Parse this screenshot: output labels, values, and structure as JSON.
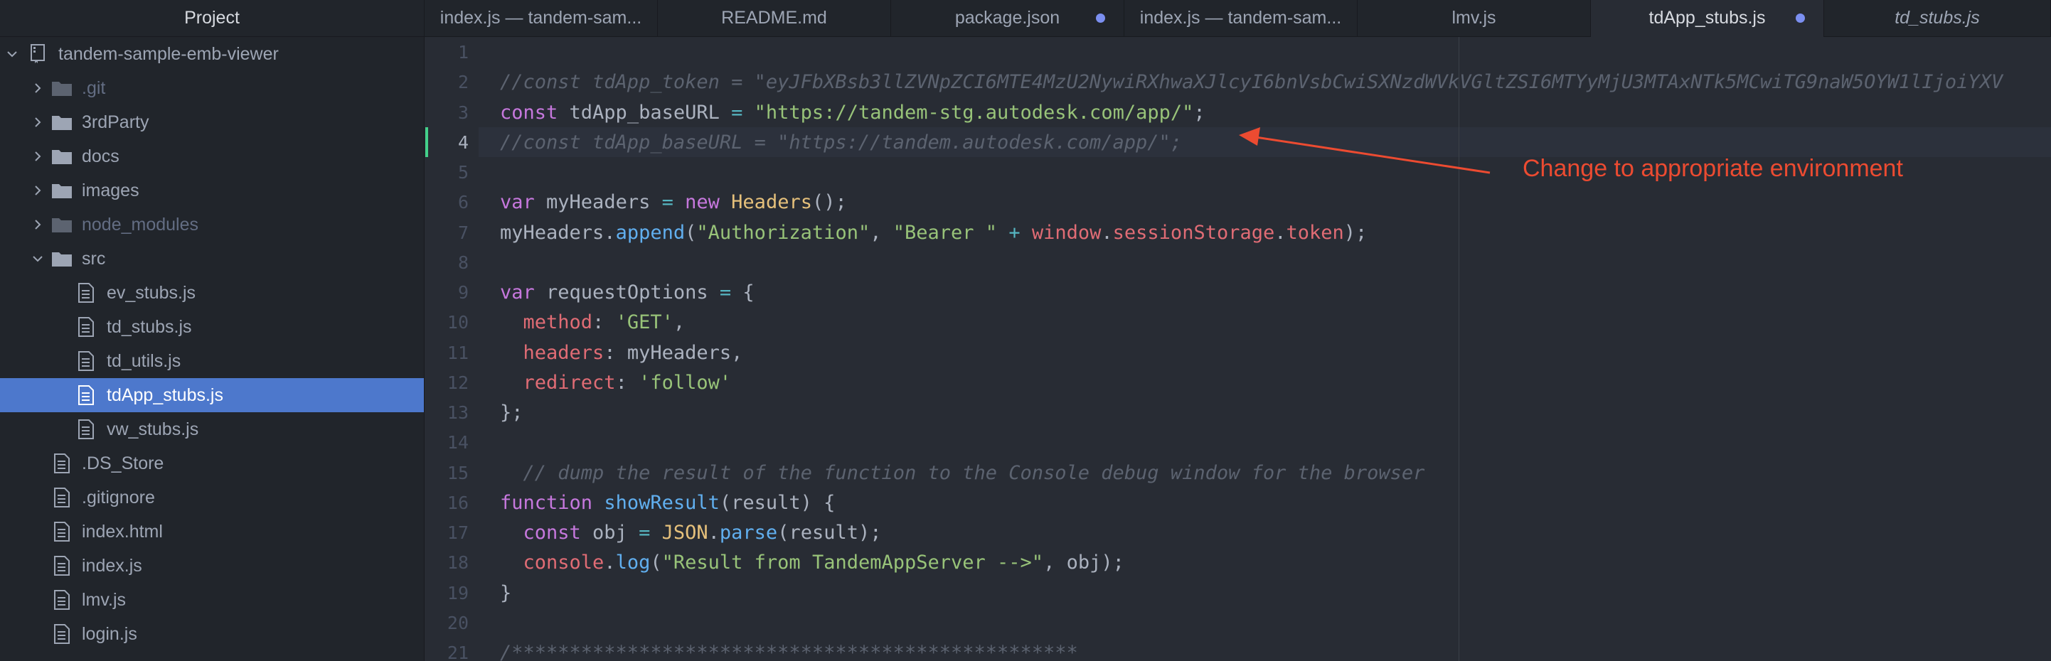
{
  "sidebar": {
    "title": "Project",
    "tree": [
      {
        "label": "tandem-sample-emb-viewer",
        "kind": "repo",
        "indent": 0,
        "expanded": true
      },
      {
        "label": ".git",
        "kind": "folder",
        "indent": 1,
        "expanded": false,
        "ignored": true
      },
      {
        "label": "3rdParty",
        "kind": "folder",
        "indent": 1,
        "expanded": false
      },
      {
        "label": "docs",
        "kind": "folder",
        "indent": 1,
        "expanded": false
      },
      {
        "label": "images",
        "kind": "folder",
        "indent": 1,
        "expanded": false
      },
      {
        "label": "node_modules",
        "kind": "folder",
        "indent": 1,
        "expanded": false,
        "ignored": true
      },
      {
        "label": "src",
        "kind": "folder",
        "indent": 1,
        "expanded": true
      },
      {
        "label": "ev_stubs.js",
        "kind": "file",
        "indent": 2
      },
      {
        "label": "td_stubs.js",
        "kind": "file",
        "indent": 2
      },
      {
        "label": "td_utils.js",
        "kind": "file",
        "indent": 2
      },
      {
        "label": "tdApp_stubs.js",
        "kind": "file",
        "indent": 2,
        "selected": true
      },
      {
        "label": "vw_stubs.js",
        "kind": "file",
        "indent": 2
      },
      {
        "label": ".DS_Store",
        "kind": "file",
        "indent": 1
      },
      {
        "label": ".gitignore",
        "kind": "file",
        "indent": 1
      },
      {
        "label": "index.html",
        "kind": "file",
        "indent": 1
      },
      {
        "label": "index.js",
        "kind": "file",
        "indent": 1
      },
      {
        "label": "lmv.js",
        "kind": "file",
        "indent": 1
      },
      {
        "label": "login.js",
        "kind": "file",
        "indent": 1
      }
    ]
  },
  "tabs": [
    {
      "title": "index.js — tandem-sam...",
      "active": false,
      "modified": false,
      "preview": false
    },
    {
      "title": "README.md",
      "active": false,
      "modified": false,
      "preview": false
    },
    {
      "title": "package.json",
      "active": false,
      "modified": true,
      "preview": false
    },
    {
      "title": "index.js — tandem-sam...",
      "active": false,
      "modified": false,
      "preview": false
    },
    {
      "title": "lmv.js",
      "active": false,
      "modified": false,
      "preview": false
    },
    {
      "title": "tdApp_stubs.js",
      "active": true,
      "modified": true,
      "preview": false
    },
    {
      "title": "td_stubs.js",
      "active": false,
      "modified": false,
      "preview": true
    }
  ],
  "editor": {
    "current_line": 4,
    "lines": [
      {
        "n": "1",
        "tokens": []
      },
      {
        "n": "2",
        "tokens": [
          [
            "c",
            "//const tdApp_token = \"eyJFbXBsb3llZVNpZCI6MTE4MzU2NywiRXhwaXJlcyI6bnVsbCwiSXNzdWVkVGltZSI6MTYyMjU3MTAxNTk5MCwiTG9naW5OYW1lIjoiYXV"
          ]
        ]
      },
      {
        "n": "3",
        "tokens": [
          [
            "k",
            "const"
          ],
          [
            "p",
            " tdApp_baseURL "
          ],
          [
            "o",
            "="
          ],
          [
            "p",
            " "
          ],
          [
            "s",
            "\"https://tandem-stg.autodesk.com/app/\""
          ],
          [
            "p",
            ";"
          ]
        ]
      },
      {
        "n": "4",
        "tokens": [
          [
            "c",
            "//const tdApp_baseURL = \"https://tandem.autodesk.com/app/\";"
          ]
        ]
      },
      {
        "n": "5",
        "tokens": []
      },
      {
        "n": "6",
        "tokens": [
          [
            "k",
            "var"
          ],
          [
            "p",
            " myHeaders "
          ],
          [
            "o",
            "="
          ],
          [
            "p",
            " "
          ],
          [
            "k",
            "new"
          ],
          [
            "p",
            " "
          ],
          [
            "y",
            "Headers"
          ],
          [
            "p",
            "();"
          ]
        ]
      },
      {
        "n": "7",
        "tokens": [
          [
            "p",
            "myHeaders."
          ],
          [
            "f",
            "append"
          ],
          [
            "p",
            "("
          ],
          [
            "s",
            "\"Authorization\""
          ],
          [
            "p",
            ", "
          ],
          [
            "s",
            "\"Bearer \""
          ],
          [
            "p",
            " "
          ],
          [
            "o",
            "+"
          ],
          [
            "p",
            " "
          ],
          [
            "r",
            "window"
          ],
          [
            "p",
            "."
          ],
          [
            "r",
            "sessionStorage"
          ],
          [
            "p",
            "."
          ],
          [
            "r",
            "token"
          ],
          [
            "p",
            ");"
          ]
        ]
      },
      {
        "n": "8",
        "tokens": []
      },
      {
        "n": "9",
        "tokens": [
          [
            "k",
            "var"
          ],
          [
            "p",
            " requestOptions "
          ],
          [
            "o",
            "="
          ],
          [
            "p",
            " {"
          ]
        ]
      },
      {
        "n": "10",
        "tokens": [
          [
            "p",
            "  "
          ],
          [
            "r",
            "method"
          ],
          [
            "p",
            ": "
          ],
          [
            "s",
            "'GET'"
          ],
          [
            "p",
            ","
          ]
        ]
      },
      {
        "n": "11",
        "tokens": [
          [
            "p",
            "  "
          ],
          [
            "r",
            "headers"
          ],
          [
            "p",
            ": myHeaders,"
          ]
        ]
      },
      {
        "n": "12",
        "tokens": [
          [
            "p",
            "  "
          ],
          [
            "r",
            "redirect"
          ],
          [
            "p",
            ": "
          ],
          [
            "s",
            "'follow'"
          ]
        ]
      },
      {
        "n": "13",
        "tokens": [
          [
            "p",
            "};"
          ]
        ]
      },
      {
        "n": "14",
        "tokens": []
      },
      {
        "n": "15",
        "tokens": [
          [
            "p",
            "  "
          ],
          [
            "c",
            "// dump the result of the function to the Console debug window for the browser"
          ]
        ]
      },
      {
        "n": "16",
        "tokens": [
          [
            "k",
            "function"
          ],
          [
            "p",
            " "
          ],
          [
            "f",
            "showResult"
          ],
          [
            "p",
            "(result) {"
          ]
        ]
      },
      {
        "n": "17",
        "tokens": [
          [
            "p",
            "  "
          ],
          [
            "k",
            "const"
          ],
          [
            "p",
            " obj "
          ],
          [
            "o",
            "="
          ],
          [
            "p",
            " "
          ],
          [
            "y",
            "JSON"
          ],
          [
            "p",
            "."
          ],
          [
            "f",
            "parse"
          ],
          [
            "p",
            "(result);"
          ]
        ]
      },
      {
        "n": "18",
        "tokens": [
          [
            "p",
            "  "
          ],
          [
            "r",
            "console"
          ],
          [
            "p",
            "."
          ],
          [
            "f",
            "log"
          ],
          [
            "p",
            "("
          ],
          [
            "s",
            "\"Result from TandemAppServer -->\""
          ],
          [
            "p",
            ", obj);"
          ]
        ]
      },
      {
        "n": "19",
        "tokens": [
          [
            "p",
            "}"
          ]
        ]
      },
      {
        "n": "20",
        "tokens": []
      },
      {
        "n": "21",
        "tokens": [
          [
            "c",
            "/*************************************************"
          ]
        ]
      }
    ]
  },
  "annotation": {
    "text": "Change to appropriate environment",
    "color": "#ec4b31"
  },
  "colors": {
    "accent": "#4d78cc",
    "modified_dot": "#7b8ff0"
  }
}
